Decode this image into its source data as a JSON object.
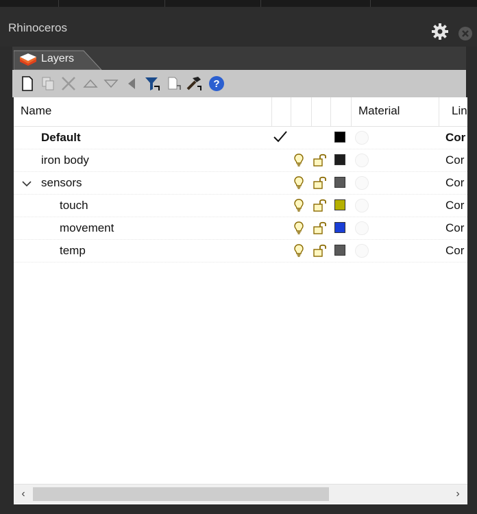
{
  "window": {
    "title": "Rhinoceros"
  },
  "tab": {
    "label": "Layers"
  },
  "toolbar": {
    "icons": [
      "new-layer-icon",
      "new-sublayer-icon",
      "delete-icon",
      "move-up-icon",
      "move-down-icon",
      "move-to-parent-icon",
      "filter-icon",
      "copy-icon",
      "tools-icon",
      "help-icon"
    ]
  },
  "table": {
    "headers": {
      "name": "Name",
      "material": "Material",
      "linetype": "Lin"
    },
    "rows": [
      {
        "name": "Default",
        "current": true,
        "color": "#000000",
        "linetype": "Cor",
        "bold": true
      },
      {
        "name": "iron body",
        "color": "#1e1e1e",
        "linetype": "Cor"
      },
      {
        "name": "sensors",
        "expanded": true,
        "color": "#5a5a5a",
        "linetype": "Cor"
      },
      {
        "name": "touch",
        "color": "#b5b000",
        "linetype": "Cor"
      },
      {
        "name": "movement",
        "color": "#1a3fd6",
        "linetype": "Cor"
      },
      {
        "name": "temp",
        "color": "#5a5a5a",
        "linetype": "Cor"
      }
    ]
  },
  "scrollbar": {
    "left_arrow": "‹",
    "right_arrow": "›"
  }
}
